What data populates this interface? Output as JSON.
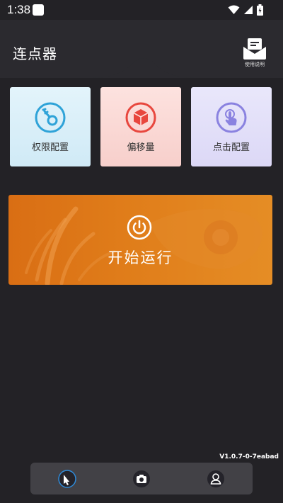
{
  "status_bar": {
    "time": "1:38",
    "icons": [
      "notification-square-icon",
      "wifi-icon",
      "signal-icon",
      "battery-charging-icon"
    ]
  },
  "header": {
    "title": "连点器",
    "help_label": "使用说明",
    "help_icon": "envelope-icon"
  },
  "cards": [
    {
      "label": "权限配置",
      "icon": "key-icon",
      "accent": "#2fa3d8"
    },
    {
      "label": "偏移量",
      "icon": "cube-icon",
      "accent": "#e8473e"
    },
    {
      "label": "点击配置",
      "icon": "touch-finger-icon",
      "accent": "#8a82e0"
    }
  ],
  "start_panel": {
    "label": "开始运行",
    "icon": "power-icon",
    "color": "#e07d1a"
  },
  "version": "V1.0.7-0-7eabad",
  "bottom_nav": {
    "items": [
      {
        "icon": "hand-cursor-icon"
      },
      {
        "icon": "camera-icon"
      },
      {
        "icon": "user-icon"
      }
    ]
  }
}
